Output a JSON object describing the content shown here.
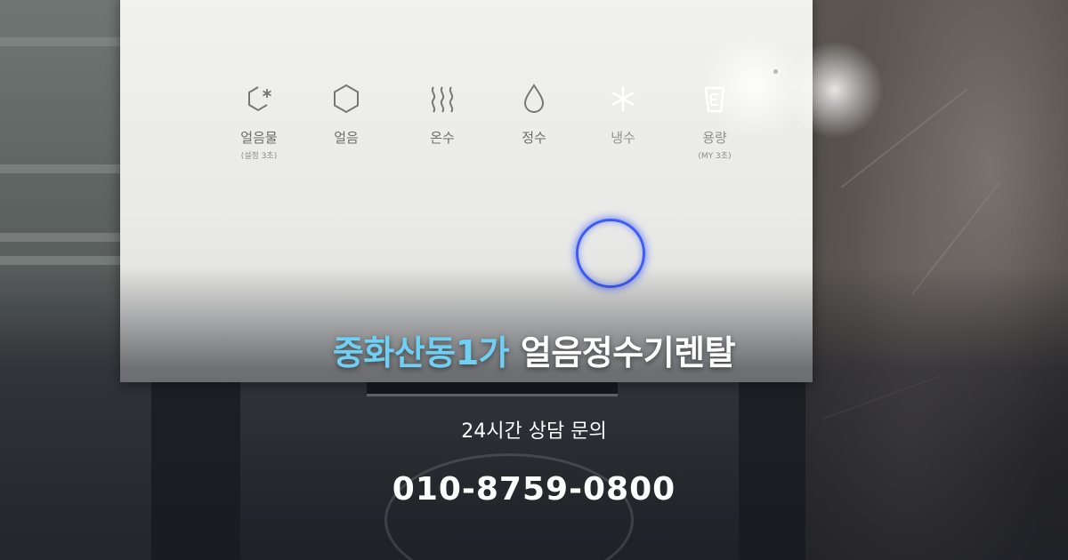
{
  "panel": {
    "buttons": [
      {
        "icon": "ice-water-icon",
        "label": "얼음물",
        "sub": "(설정 3초)",
        "lit": false
      },
      {
        "icon": "ice-hexagon-icon",
        "label": "얼음",
        "sub": "",
        "lit": false
      },
      {
        "icon": "hot-water-steam-icon",
        "label": "온수",
        "sub": "",
        "lit": false
      },
      {
        "icon": "water-drop-icon",
        "label": "정수",
        "sub": "",
        "lit": false
      },
      {
        "icon": "cold-snowflake-icon",
        "label": "냉수",
        "sub": "",
        "lit": true
      },
      {
        "icon": "cup-volume-icon",
        "label": "용량",
        "sub": "(MY 3초)",
        "lit": true
      }
    ],
    "dispense_ring_color": "#3f5bf2"
  },
  "overlay": {
    "headline_accent": "중화산동1가",
    "headline_main": "얼음정수기렌탈",
    "subline": "24시간 상담 문의",
    "phone": "010-8759-0800",
    "accent_color": "#6fd0f4"
  }
}
